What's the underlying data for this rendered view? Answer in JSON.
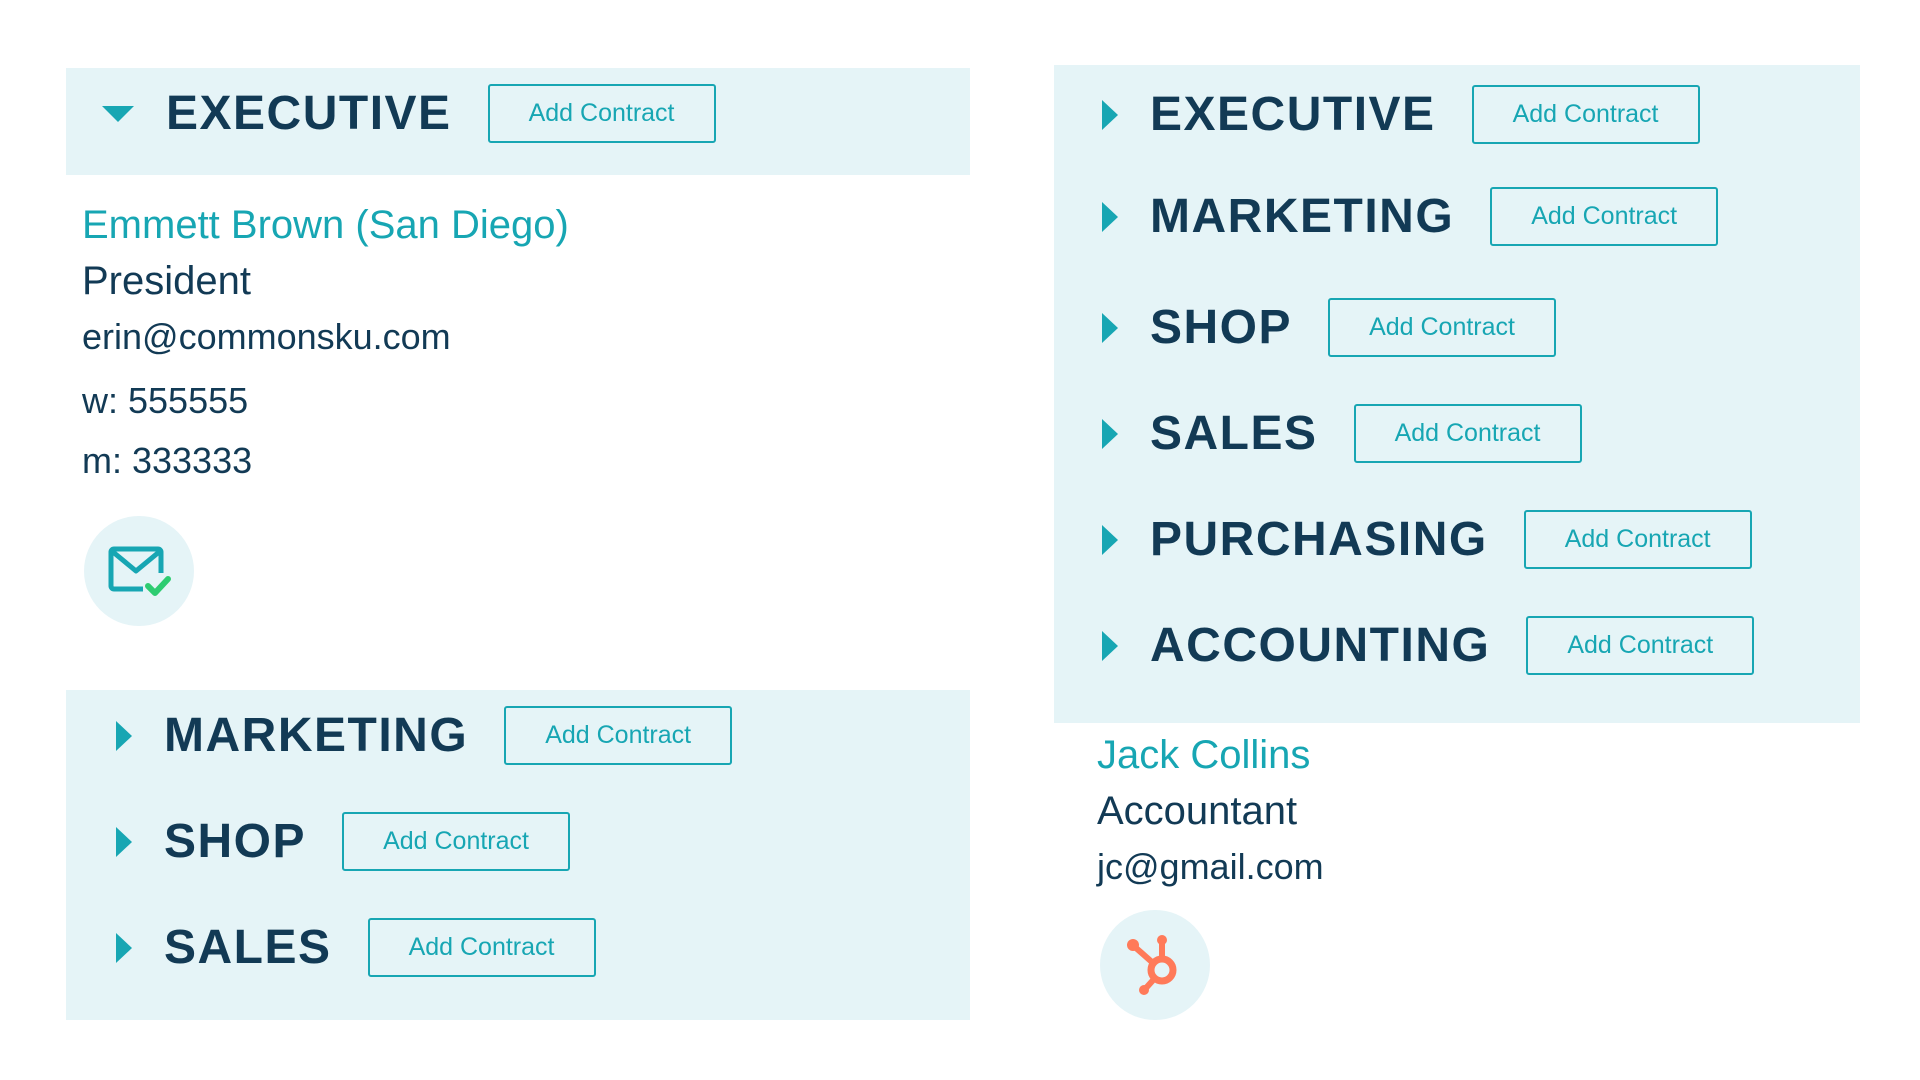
{
  "colors": {
    "accent": "#17a6b3",
    "heading": "#123a55",
    "panel_bg": "#e5f4f7",
    "hubspot": "#ff7a59",
    "check_green": "#2ecc71"
  },
  "left": {
    "executive": {
      "label": "EXECUTIVE",
      "expanded": true,
      "button": "Add Contract"
    },
    "contact": {
      "name": "Emmett Brown (San Diego)",
      "title": "President",
      "email": "erin@commonsku.com",
      "work_phone": "w: 555555",
      "mobile_phone": "m: 333333",
      "icon": "email-verified-icon"
    },
    "departments": [
      {
        "label": "MARKETING",
        "button": "Add Contract"
      },
      {
        "label": "SHOP",
        "button": "Add Contract"
      },
      {
        "label": "SALES",
        "button": "Add Contract"
      }
    ]
  },
  "right": {
    "departments": [
      {
        "label": "EXECUTIVE",
        "button": "Add Contract"
      },
      {
        "label": "MARKETING",
        "button": "Add Contract"
      },
      {
        "label": "SHOP",
        "button": "Add Contract"
      },
      {
        "label": "SALES",
        "button": "Add Contract"
      },
      {
        "label": "PURCHASING",
        "button": "Add Contract"
      },
      {
        "label": "ACCOUNTING",
        "button": "Add Contract"
      }
    ],
    "contact": {
      "name": "Jack Collins",
      "title": "Accountant",
      "email": "jc@gmail.com",
      "icon": "hubspot-icon"
    }
  }
}
